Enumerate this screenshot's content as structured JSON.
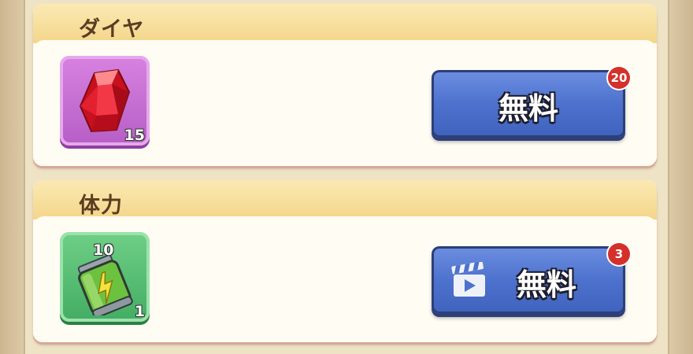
{
  "sections": [
    {
      "title": "ダイヤ",
      "item": {
        "icon": "red-gem-icon",
        "count": "15"
      },
      "button": {
        "label": "無料",
        "badge": "20",
        "has_video_icon": false
      }
    },
    {
      "title": "体力",
      "item": {
        "icon": "stamina-battery-icon",
        "top_label": "10",
        "count": "1"
      },
      "button": {
        "label": "無料",
        "badge": "3",
        "has_video_icon": true,
        "icon": "video-clapper-icon"
      }
    }
  ],
  "colors": {
    "header": "#f4d68a",
    "button_blue": "#4d72cd",
    "badge_red": "#d5302a",
    "tile_purple": "#c36ed1",
    "tile_green": "#4fb86d"
  }
}
